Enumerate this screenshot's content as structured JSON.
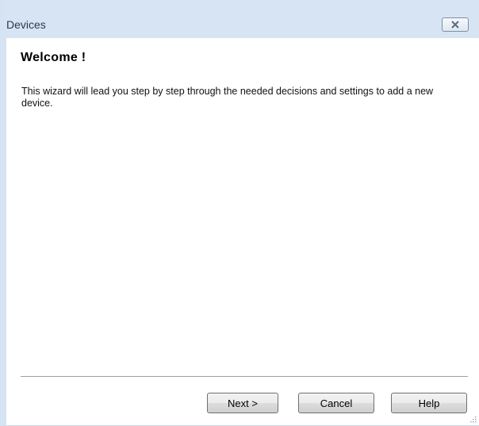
{
  "window": {
    "title": "Devices",
    "close_icon": "close-x-icon"
  },
  "wizard": {
    "heading": "Welcome !",
    "description": "This wizard will lead you step by step through the needed decisions and settings to add a new device."
  },
  "buttons": {
    "next_label": "Next >",
    "cancel_label": "Cancel",
    "help_label": "Help"
  },
  "colors": {
    "titlebar": "#d6e4f3",
    "background": "#ffffff"
  }
}
